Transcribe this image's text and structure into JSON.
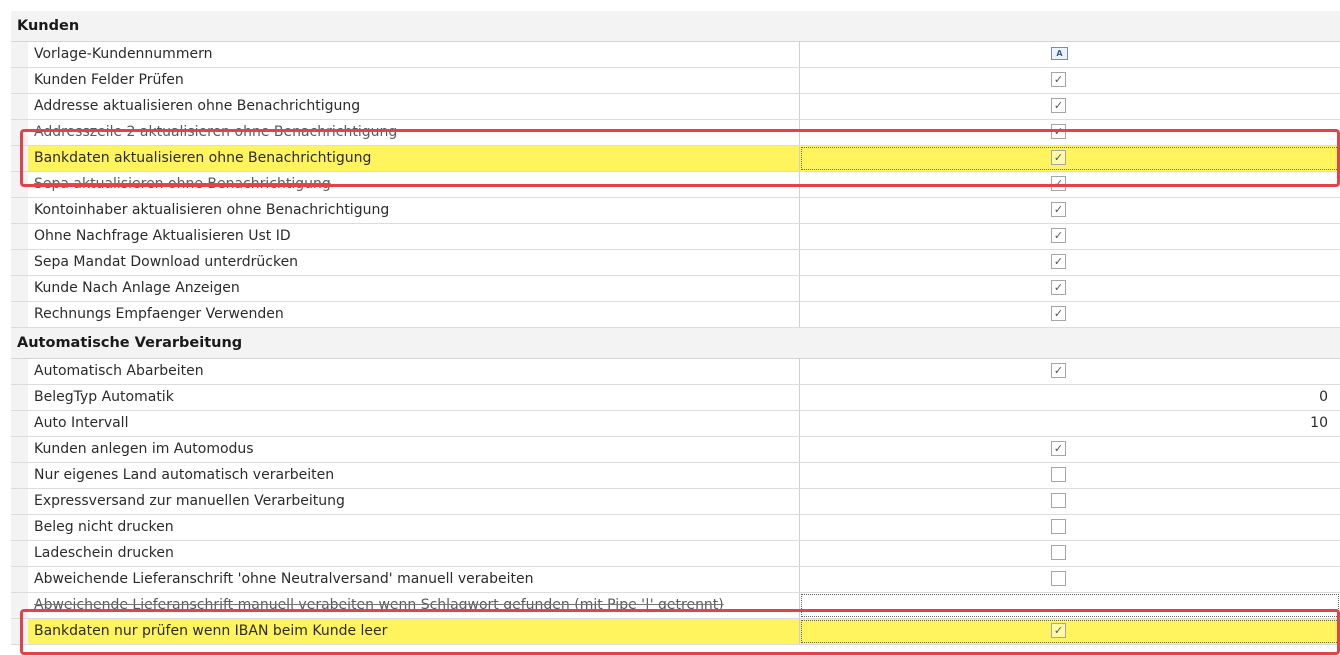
{
  "sections": [
    {
      "title": "Kunden",
      "rows": [
        {
          "label": "Vorlage-Kundennummern",
          "type": "editor",
          "icon": "A"
        },
        {
          "label": "Kunden Felder Prüfen",
          "type": "check",
          "checked": true
        },
        {
          "label": "Addresse aktualisieren ohne Benachrichtigung",
          "type": "check",
          "checked": true
        },
        {
          "label": "Addresszeile 2 aktualisieren ohne Benachrichtigung",
          "type": "check",
          "checked": true
        },
        {
          "label": "Bankdaten aktualisieren ohne Benachrichtigung",
          "type": "check",
          "checked": true,
          "highlighted": true
        },
        {
          "label": "Sepa aktualisieren ohne Benachrichtigung",
          "type": "check",
          "checked": true
        },
        {
          "label": "Kontoinhaber aktualisieren ohne Benachrichtigung",
          "type": "check",
          "checked": true
        },
        {
          "label": "Ohne Nachfrage Aktualisieren Ust ID",
          "type": "check",
          "checked": true
        },
        {
          "label": "Sepa Mandat Download unterdrücken",
          "type": "check",
          "checked": true
        },
        {
          "label": "Kunde Nach Anlage Anzeigen",
          "type": "check",
          "checked": true
        },
        {
          "label": "Rechnungs Empfaenger Verwenden",
          "type": "check",
          "checked": true
        }
      ]
    },
    {
      "title": "Automatische Verarbeitung",
      "rows": [
        {
          "label": "Automatisch Abarbeiten",
          "type": "check",
          "checked": true
        },
        {
          "label": "BelegTyp Automatik",
          "type": "number",
          "value": "0"
        },
        {
          "label": "Auto Intervall",
          "type": "number",
          "value": "10"
        },
        {
          "label": "Kunden anlegen im Automodus",
          "type": "check",
          "checked": true
        },
        {
          "label": "Nur eigenes Land automatisch verarbeiten",
          "type": "check",
          "checked": false
        },
        {
          "label": "Expressversand zur manuellen Verarbeitung",
          "type": "check",
          "checked": false
        },
        {
          "label": "Beleg nicht drucken",
          "type": "check",
          "checked": false
        },
        {
          "label": "Ladeschein drucken",
          "type": "check",
          "checked": false
        },
        {
          "label": "Abweichende Lieferanschrift 'ohne Neutralversand' manuell verabeiten",
          "type": "check",
          "checked": false
        },
        {
          "label": "Abweichende Lieferanschrift manuell verabeiten wenn Schlagwort gefunden (mit Pipe '|' getrennt)",
          "type": "text",
          "value": ""
        },
        {
          "label": "Bankdaten nur prüfen wenn IBAN beim Kunde leer",
          "type": "check",
          "checked": true,
          "highlighted": true
        }
      ]
    }
  ],
  "check_glyph": "✓",
  "colors": {
    "highlight": "#fff45e",
    "annotation_box": "#e2434b",
    "category_bg": "#f3f3f3"
  }
}
